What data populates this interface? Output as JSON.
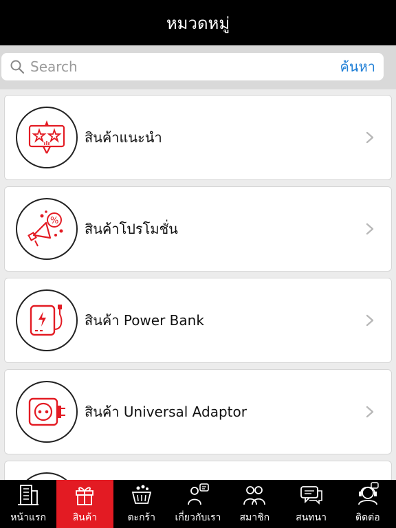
{
  "header": {
    "title": "หมวดหมู่"
  },
  "search": {
    "placeholder": "Search",
    "button_label": "ค้นหา"
  },
  "categories": [
    {
      "label": "สินค้าแนะนำ",
      "icon": "recommended-stars-icon"
    },
    {
      "label": "สินค้าโปรโมชั่น",
      "icon": "promotion-megaphone-icon"
    },
    {
      "label": "สินค้า Power Bank",
      "icon": "power-bank-icon"
    },
    {
      "label": "สินค้า Universal Adaptor",
      "icon": "universal-adaptor-icon"
    }
  ],
  "tabs": [
    {
      "label": "หน้าแรก",
      "icon": "building-icon",
      "active": false
    },
    {
      "label": "สินค้า",
      "icon": "gift-icon",
      "active": true
    },
    {
      "label": "ตะกร้า",
      "icon": "basket-icon",
      "active": false
    },
    {
      "label": "เกี่ยวกับเรา",
      "icon": "about-us-icon",
      "active": false
    },
    {
      "label": "สมาชิก",
      "icon": "members-icon",
      "active": false
    },
    {
      "label": "สนทนา",
      "icon": "chat-icon",
      "active": false
    },
    {
      "label": "ติดต่อ",
      "icon": "contact-icon",
      "active": false
    }
  ],
  "colors": {
    "accent": "#e31b23",
    "link": "#1f7fd6",
    "bar": "#000000"
  }
}
